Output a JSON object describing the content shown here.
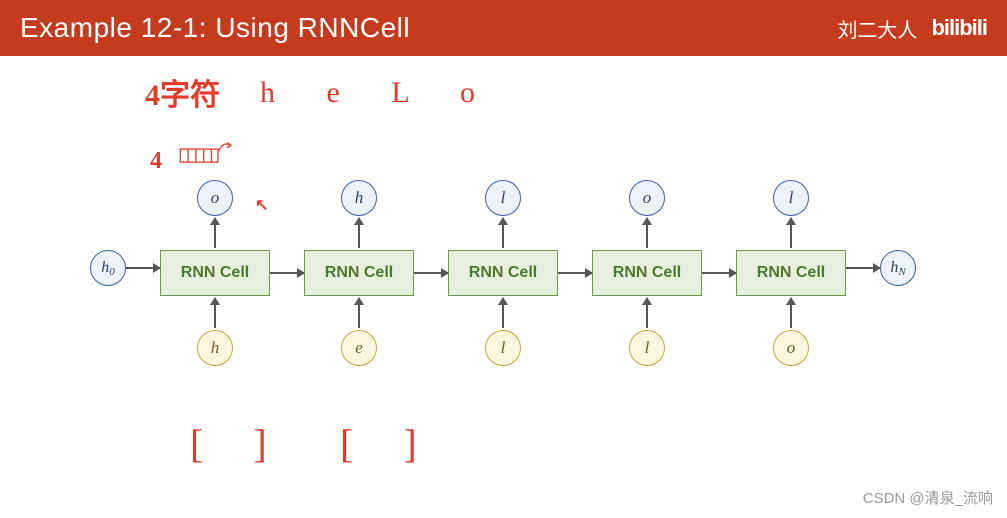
{
  "header": {
    "title": "Example 12-1: Using RNNCell",
    "author": "刘二大人",
    "logo": "bilibili"
  },
  "handwriting": {
    "label_chars": "4字符",
    "letters": "h e L o",
    "label_four": "4",
    "bracket1": "[ ]",
    "bracket2": "[ ]"
  },
  "diagram": {
    "h_start": "h",
    "h_start_sub": "0",
    "h_end": "h",
    "h_end_sub": "N",
    "cell_label": "RNN Cell",
    "cells": [
      {
        "input": "h",
        "output": "o"
      },
      {
        "input": "e",
        "output": "h"
      },
      {
        "input": "l",
        "output": "l"
      },
      {
        "input": "l",
        "output": "o"
      },
      {
        "input": "o",
        "output": "l"
      }
    ]
  },
  "watermark": "CSDN @清泉_流响"
}
